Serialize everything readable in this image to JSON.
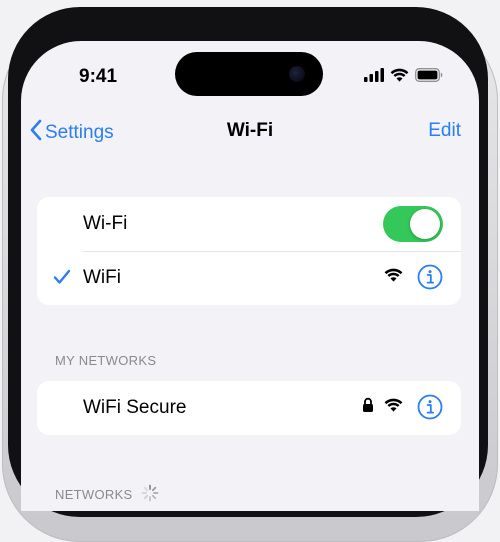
{
  "status_bar": {
    "time": "9:41"
  },
  "nav": {
    "back_label": "Settings",
    "title": "Wi-Fi",
    "edit_label": "Edit"
  },
  "wifi_toggle": {
    "label": "Wi-Fi",
    "on": true
  },
  "connected_network": {
    "name": "WiFi",
    "selected": true
  },
  "my_networks": {
    "header": "MY NETWORKS",
    "items": [
      {
        "name": "WiFi Secure",
        "locked": true
      }
    ]
  },
  "networks": {
    "header": "NETWORKS"
  },
  "colors": {
    "accent": "#2a7df4",
    "toggle_on": "#34c759",
    "group_bg": "#f2f2f7"
  },
  "icons": [
    "wifi-icon",
    "cellular-icon",
    "battery-icon",
    "chevron-left-icon",
    "checkmark-icon",
    "info-icon",
    "lock-icon",
    "spinner-icon"
  ]
}
